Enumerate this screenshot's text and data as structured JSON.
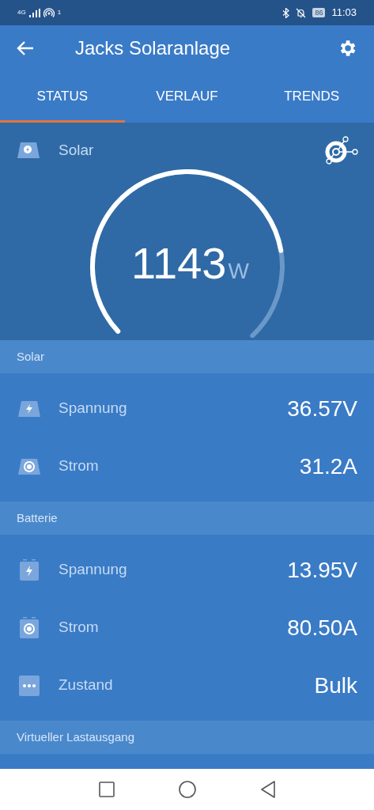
{
  "status_bar": {
    "network": "4G",
    "hotspot_count": "1",
    "battery": "86",
    "time": "11:03"
  },
  "app_bar": {
    "title": "Jacks Solaranlage"
  },
  "tabs": [
    {
      "label": "STATUS",
      "selected": true
    },
    {
      "label": "VERLAUF",
      "selected": false
    },
    {
      "label": "TRENDS",
      "selected": false
    }
  ],
  "gauge": {
    "label": "Solar",
    "value": "1143",
    "unit": "W"
  },
  "sections": [
    {
      "title": "Solar",
      "rows": [
        {
          "kind": "panel-bolt",
          "label": "Spannung",
          "value": "36.57V"
        },
        {
          "kind": "panel-current",
          "label": "Strom",
          "value": "31.2A"
        }
      ]
    },
    {
      "title": "Batterie",
      "rows": [
        {
          "kind": "battery-bolt",
          "label": "Spannung",
          "value": "13.95V"
        },
        {
          "kind": "battery-current",
          "label": "Strom",
          "value": "80.50A"
        },
        {
          "kind": "dots",
          "label": "Zustand",
          "value": "Bulk"
        }
      ]
    },
    {
      "title": "Virtueller Lastausgang"
    }
  ]
}
